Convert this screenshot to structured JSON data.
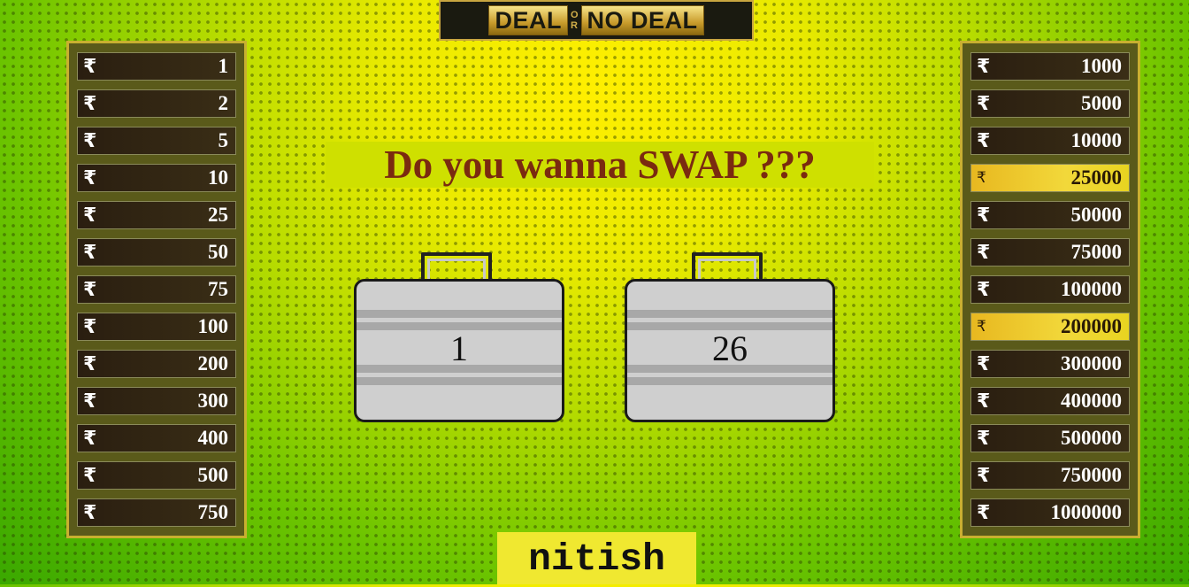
{
  "logo": {
    "deal": "DEAL",
    "or_top": "O",
    "or_bottom": "R",
    "no_deal": "NO DEAL"
  },
  "currency_symbol": "₹",
  "left_board": [
    {
      "value": "1",
      "opened": false
    },
    {
      "value": "2",
      "opened": false
    },
    {
      "value": "5",
      "opened": false
    },
    {
      "value": "10",
      "opened": false
    },
    {
      "value": "25",
      "opened": false
    },
    {
      "value": "50",
      "opened": false
    },
    {
      "value": "75",
      "opened": false
    },
    {
      "value": "100",
      "opened": false
    },
    {
      "value": "200",
      "opened": false
    },
    {
      "value": "300",
      "opened": false
    },
    {
      "value": "400",
      "opened": false
    },
    {
      "value": "500",
      "opened": false
    },
    {
      "value": "750",
      "opened": false
    }
  ],
  "right_board": [
    {
      "value": "1000",
      "opened": false
    },
    {
      "value": "5000",
      "opened": false
    },
    {
      "value": "10000",
      "opened": false
    },
    {
      "value": "25000",
      "opened": true
    },
    {
      "value": "50000",
      "opened": false
    },
    {
      "value": "75000",
      "opened": false
    },
    {
      "value": "100000",
      "opened": false
    },
    {
      "value": "200000",
      "opened": true
    },
    {
      "value": "300000",
      "opened": false
    },
    {
      "value": "400000",
      "opened": false
    },
    {
      "value": "500000",
      "opened": false
    },
    {
      "value": "750000",
      "opened": false
    },
    {
      "value": "1000000",
      "opened": false
    }
  ],
  "question": "Do you wanna SWAP ???",
  "cases": [
    {
      "number": "1"
    },
    {
      "number": "26"
    }
  ],
  "player_name": "nitish"
}
